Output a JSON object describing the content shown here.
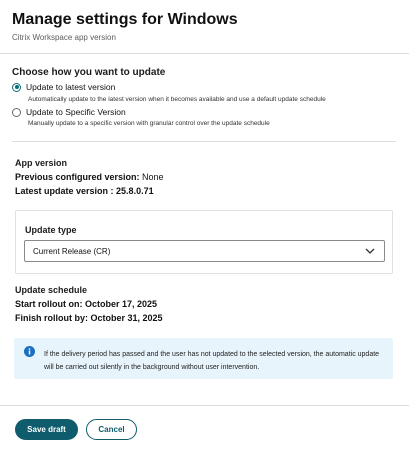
{
  "header": {
    "title": "Manage settings for Windows",
    "subtitle": "Citrix Workspace app version"
  },
  "update_method": {
    "title": "Choose how you want to update",
    "options": [
      {
        "label": "Update to latest version",
        "description": "Automatically update to the latest version when it becomes available and use a default update schedule",
        "selected": true
      },
      {
        "label": "Update to Specific Version",
        "description": "Manually update to a specific version with granular control over the update schedule",
        "selected": false
      }
    ]
  },
  "app_version": {
    "title": "App version",
    "previous_label": "Previous configured version:",
    "previous_value": "None",
    "latest_label": "Latest update version :",
    "latest_value": "25.8.0.71"
  },
  "update_type": {
    "label": "Update type",
    "selected": "Current Release (CR)"
  },
  "schedule": {
    "title": "Update schedule",
    "start_label": "Start rollout on:",
    "start_value": "October 17, 2025",
    "finish_label": "Finish rollout by:",
    "finish_value": "October 31, 2025"
  },
  "notice": {
    "text": "If the delivery period has passed and the user has not updated to the selected version, the automatic update will be carried out silently in the background without user intervention."
  },
  "footer": {
    "save_label": "Save draft",
    "cancel_label": "Cancel"
  },
  "colors": {
    "accent": "#0f5c6d",
    "notice_bg": "#e8f4fb",
    "info_icon": "#1a6fc0"
  }
}
